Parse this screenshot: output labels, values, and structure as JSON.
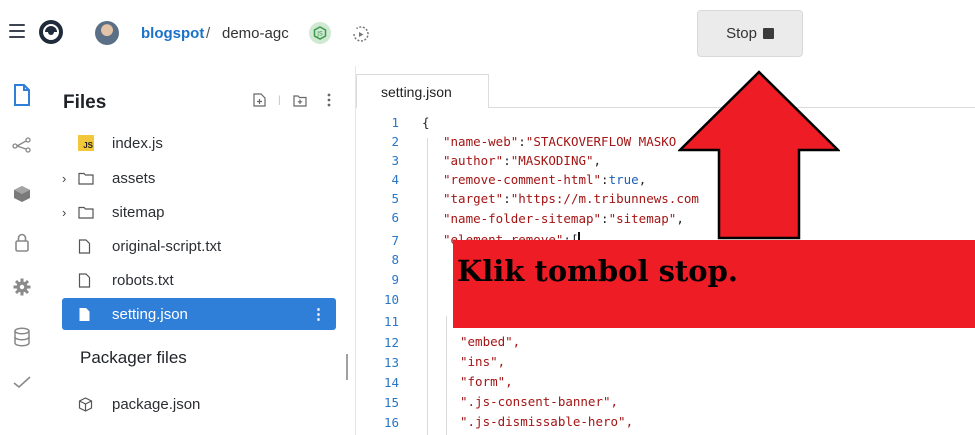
{
  "header": {
    "repo_owner": "blogspot",
    "repo_separator": "/",
    "repo_name": "demo-agc",
    "stop_label": "Stop"
  },
  "sidebar": {
    "title": "Files",
    "items": [
      {
        "label": "index.js",
        "type": "js-file"
      },
      {
        "label": "assets",
        "type": "folder"
      },
      {
        "label": "sitemap",
        "type": "folder"
      },
      {
        "label": "original-script.txt",
        "type": "file"
      },
      {
        "label": "robots.txt",
        "type": "file"
      },
      {
        "label": "setting.json",
        "type": "file",
        "active": true
      }
    ],
    "packager_title": "Packager files",
    "packager_items": [
      {
        "label": "package.json",
        "type": "package"
      }
    ]
  },
  "editor": {
    "tab_label": "setting.json",
    "line_numbers": [
      "1",
      "2",
      "3",
      "4",
      "5",
      "6",
      "7",
      "8",
      "9",
      "10",
      "11",
      "12",
      "13",
      "14",
      "15",
      "16"
    ],
    "lines": {
      "l1": "{",
      "l2_key": "\"name-web\"",
      "l2_val": "\"STACKOVERFLOW MASKO",
      "l3_key": "\"author\"",
      "l3_val": "\"MASKODING\"",
      "l4_key": "\"remove-comment-html\"",
      "l4_val": "true",
      "l5_key": "\"target\"",
      "l5_val": "\"https://m.tribunnews.com",
      "l6_key": "\"name-folder-sitemap\"",
      "l6_val": "\"sitemap\"",
      "l7_key": "\"element-remove\"",
      "l7_val": "[",
      "l12": "\"embed\",",
      "l13": "\"ins\",",
      "l14": "\"form\",",
      "l15": "\".js-consent-banner\",",
      "l16": "\".js-dismissable-hero\","
    }
  },
  "annotation": {
    "banner_text": "Klik tombol stop.",
    "banner_color": "#ee1c24",
    "arrow_color": "#ee1c24"
  },
  "colors": {
    "accent": "#2f7ed8",
    "link": "#1b72c8",
    "line_number": "#2a76c6",
    "string": "#a31515"
  },
  "icons": {
    "activity_bar": [
      "file-icon",
      "git-branch-icon",
      "package-icon",
      "lock-icon",
      "gear-icon",
      "database-icon",
      "check-icon"
    ]
  }
}
